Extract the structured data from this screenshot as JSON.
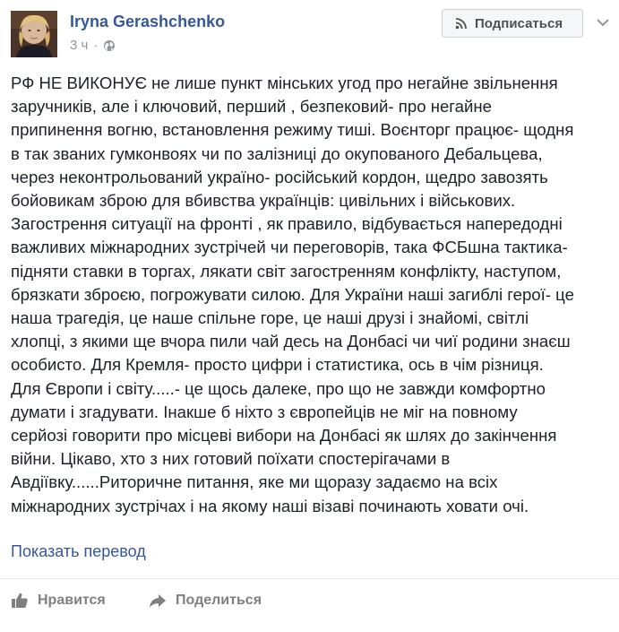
{
  "post": {
    "author": "Iryna Gerashchenko",
    "time": "3 ч",
    "dot": "·",
    "subscribe_label": "Подписаться",
    "text_lines": [
      "РФ НЕ ВИКОНУЄ не лише пункт мінських угод про негайне звільнення",
      "заручників, але і ключовий, перший , безпековий- про негайне",
      "припинення вогню, встановлення режиму тиші. Воєнторг працює- щодня",
      "в так званих гумконвоях чи по залізниці до окупованого Дебальцева,",
      "через неконтрольований україно- російський кордон, щедро завозять",
      "бойовикам зброю для вбивства українців: цивільних і військових.",
      "Загострення ситуації на фронті , як правило, відбувається напередодні",
      "важливих міжнародних зустрічей чи переговорів, така ФСБшна тактика-",
      "підняти ставки в торгах, лякати світ загостренням конфлікту, наступом,",
      "брязкати зброєю, погрожувати силою. Для України наші загиблі герої- це",
      "наша трагедія, це наше спільне горе, це наші друзі і знайомі, світлі",
      "хлопці, з якими ще вчора пили чай десь на Донбасі чи чиї родини знаєш",
      "особисто. Для Кремля- просто цифри і статистика, ось в чім різниця.",
      "Для Європи і світу.....- це щось далеке, про що не завжди комфортно",
      "думати і згадувати. Інакше б ніхто з європейців не міг на повному",
      "серйозі говорити про місцеві вибори на Донбасі як шлях до закінчення",
      "війни. Цікаво, хто з них готовий поїхати спостерігачами в",
      "Авдіївку......Риторичне питання, яке ми щоразу задаємо на всіх",
      "міжнародних зустрічах і на якому наші візаві починають ховати очі."
    ],
    "translate_label": "Показать перевод",
    "like_label": "Нравится",
    "share_label": "Поделиться"
  },
  "colors": {
    "link": "#365899",
    "text": "#1d2129",
    "meta": "#90949c",
    "action": "#7f7f7f"
  }
}
